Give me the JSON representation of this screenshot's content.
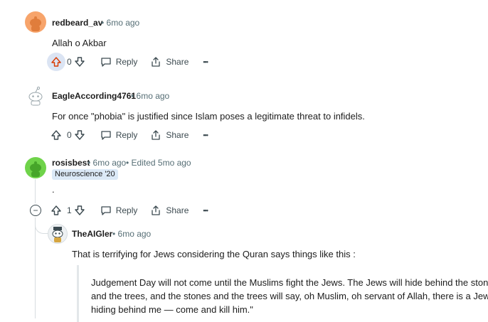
{
  "comments": [
    {
      "username": "redbeard_av",
      "time": "• 6mo ago",
      "body": "Allah o Akbar",
      "score": "0",
      "actions": {
        "reply": "Reply",
        "share": "Share",
        "more": "•••"
      }
    },
    {
      "username": "EagleAccording4761",
      "time": "• 6mo ago",
      "body": "For once \"phobia\" is justified since Islam poses a legitimate threat to infidels.",
      "score": "0",
      "actions": {
        "reply": "Reply",
        "share": "Share",
        "more": "•••"
      }
    },
    {
      "username": "rosisbest",
      "time": "• 6mo ago",
      "edited": "• Edited 5mo ago",
      "flair": "Neuroscience '20",
      "body": ".",
      "score": "1",
      "actions": {
        "reply": "Reply",
        "share": "Share",
        "more": "•••"
      },
      "collapse": "−"
    },
    {
      "username": "TheAIGler",
      "time": "• 6mo ago",
      "body": "That is terrifying for Jews considering the Quran says things like this :",
      "quote": [
        "Judgement Day will not come until the Muslims fight the Jews. The Jews will hide behind the stones",
        "and the trees, and the stones and the trees will say, oh Muslim, oh servant of Allah, there is a Jew",
        "hiding behind me — come and kill him.\""
      ]
    }
  ],
  "colors": {
    "upvote_active": "#d93a00",
    "vote_highlight": "#dbe4f3",
    "avatar_orange": "#f7a46b",
    "avatar_green": "#6fd34a",
    "meta_text": "#576f76"
  },
  "icons": [
    "upvote-icon",
    "downvote-icon",
    "reply-icon",
    "share-icon",
    "more-icon",
    "collapse-icon"
  ]
}
